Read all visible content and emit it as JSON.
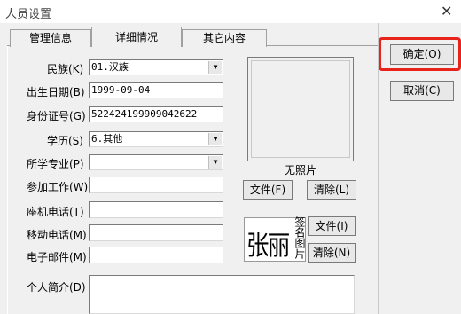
{
  "window": {
    "title": "人员设置",
    "close_icon": "✕"
  },
  "tabs": [
    {
      "label": "管理信息",
      "active": false
    },
    {
      "label": "详细情况",
      "active": true
    },
    {
      "label": "其它内容",
      "active": false
    }
  ],
  "fields": {
    "ethnicity": {
      "label": "民族(K)",
      "value": "01.汉族"
    },
    "birthdate": {
      "label": "出生日期(B)",
      "value": "1999-09-04"
    },
    "id_number": {
      "label": "身份证号(G)",
      "value": "522424199909042622"
    },
    "education": {
      "label": "学历(S)",
      "value": "6.其他"
    },
    "major": {
      "label": "所学专业(P)",
      "value": ""
    },
    "work_start": {
      "label": "参加工作(W)",
      "value": ""
    },
    "landline": {
      "label": "座机电话(T)",
      "value": ""
    },
    "mobile": {
      "label": "移动电话(M)",
      "value": ""
    },
    "email": {
      "label": "电子邮件(M)",
      "value": ""
    },
    "bio": {
      "label": "个人简介(D)",
      "value": ""
    }
  },
  "photo": {
    "caption": "无照片",
    "file_button": "文件(F)",
    "clear_button": "清除(L)"
  },
  "signature": {
    "vertical_label": "签名图片",
    "image_text": "张丽",
    "file_button": "文件(I)",
    "clear_button": "清除(N)"
  },
  "actions": {
    "ok": "确定(O)",
    "cancel": "取消(C)"
  },
  "colors": {
    "highlight": "#e8231c"
  },
  "icons": {
    "dropdown": "▼"
  }
}
